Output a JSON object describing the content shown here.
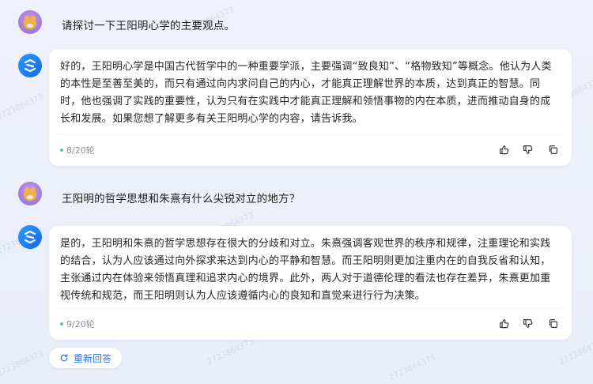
{
  "conversation": {
    "turns": [
      {
        "user_text": "请探讨一下王阳明心学的主要观点。",
        "reply_text": "好的，王阳明心学是中国古代哲学中的一种重要学派，主要强调“致良知”、“格物致知”等概念。他认为人类的本性是至善至美的，而只有通过向内求问自己的内心，才能真正理解世界的本质，达到真正的智慧。同时，他也强调了实践的重要性，认为只有在实践中才能真正理解和领悟事物的内在本质，进而推动自身的成长和发展。如果您想了解更多有关王阳明心学的内容，请告诉我。",
        "round": "8/20轮"
      },
      {
        "user_text": "王阳明的哲学思想和朱熹有什么尖锐对立的地方？",
        "reply_text": "是的，王阳明和朱熹的哲学思想存在很大的分歧和对立。朱熹强调客观世界的秩序和规律，注重理论和实践的结合，认为人应该通过向外探求来达到内心的平静和智慧。而王阳明则更加注重内在的自我反省和认知，主张通过内在体验来领悟真理和追求内心的境界。此外，两人对于道德伦理的看法也存在差异，朱熹更加重视传统和规范，而王阳明则认为人应该遵循内心的良知和直觉来进行行为决策。",
        "round": "9/20轮"
      }
    ],
    "regenerate_label": "重新回答"
  },
  "icons": {
    "like": "thumbs-up-icon",
    "dislike": "thumbs-down-icon",
    "copy": "copy-icon",
    "regenerate": "refresh-icon"
  },
  "colors": {
    "accent": "#3573f5",
    "round_dot": "#5bc2b3"
  },
  "watermark": "2723864373"
}
